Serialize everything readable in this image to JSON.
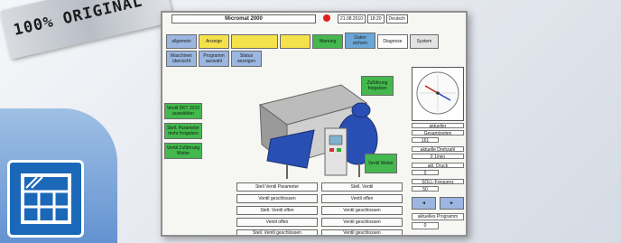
{
  "badge": {
    "text": "100% ORIGINAL"
  },
  "screen": {
    "title": "Micromat 2000",
    "date": "21.08.2010",
    "time": "18:20",
    "language": "Deutsch",
    "tabs": [
      {
        "label": "allgemein"
      },
      {
        "label": "Anzeige"
      },
      {
        "label": ""
      },
      {
        "label": ""
      },
      {
        "label": "Wartung"
      },
      {
        "label": "Daten sichern"
      },
      {
        "label": "Diagnose"
      },
      {
        "label": "System"
      }
    ],
    "subtabs": [
      {
        "label": "Maschinen übersicht"
      },
      {
        "label": "Programm auswahl"
      },
      {
        "label": "Status anzeigen"
      }
    ],
    "left_buttons": [
      {
        "label": "Ventil DKT 2010 auswählen"
      },
      {
        "label": "Stell. Parameter mehr freigeben"
      },
      {
        "label": "Ventil Zuführung Weiter"
      }
    ],
    "right_top_button": {
      "label": "Zuführung freigeben"
    },
    "right_mid_button": {
      "label": "Ventil Weiter"
    },
    "side_panel": {
      "actual_label": "aktueller",
      "operating_label": "Gesamtzeiten",
      "operating_value": "161",
      "speed_label": "aktuelle Drehzahl",
      "speed_value": "0 1/min",
      "pressure_label": "akt. Druck",
      "pressure_value": "0",
      "setpoint_label": "SOLL-Frequenz",
      "setpoint_value": "50",
      "program_label": "aktuelles Programm",
      "program_value": "0"
    },
    "bottom_grid": [
      [
        "Stell Ventil Parameter",
        "Stell. Ventil"
      ],
      [
        "Ventil geschlossen",
        "Ventil offen"
      ],
      [
        "Stell. Ventil offen",
        "Ventil geschlossen"
      ],
      [
        "Ventil offen",
        "Ventil geschlossen"
      ],
      [
        "Stell. Ventil geschlossen",
        "Ventil geschlossen"
      ]
    ],
    "nav": {
      "prev": "◄",
      "next": "►"
    }
  },
  "colors": {
    "accent_blue": "#1c68b8",
    "button_green": "#44b84e",
    "button_yellow": "#f5e24a",
    "status_red": "#e02020"
  }
}
